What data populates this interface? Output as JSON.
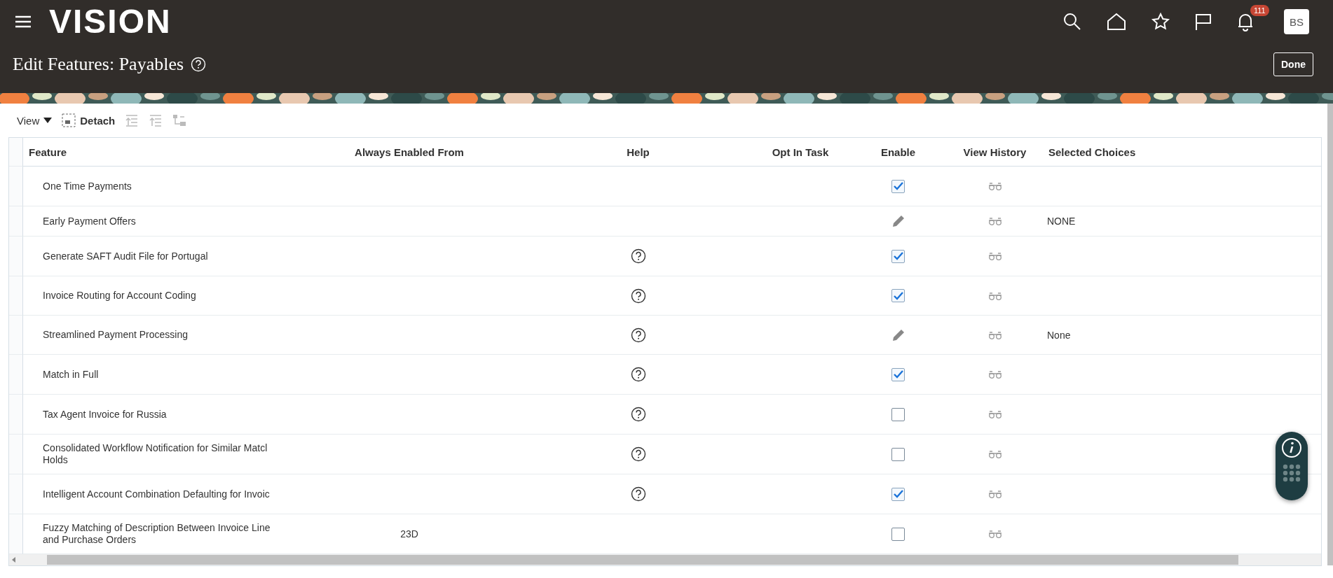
{
  "header": {
    "logo": "VISION",
    "notifications": "111",
    "avatar": "BS"
  },
  "page": {
    "title": "Edit Features: Payables",
    "done": "Done"
  },
  "toolbar": {
    "view": "View",
    "detach": "Detach"
  },
  "table": {
    "columns": [
      "Feature",
      "Always Enabled From",
      "Help",
      "Opt In Task",
      "Enable",
      "View History",
      "Selected Choices"
    ],
    "rows": [
      {
        "feature": "One Time Payments",
        "help": false,
        "enable": {
          "kind": "checkbox",
          "checked": true
        }
      },
      {
        "feature": "Early Payment Offers",
        "help": false,
        "enable": {
          "kind": "edit"
        },
        "selected_choices": "NONE"
      },
      {
        "feature": "Generate SAFT Audit File for Portugal",
        "help": true,
        "enable": {
          "kind": "checkbox",
          "checked": true
        }
      },
      {
        "feature": "Invoice Routing for Account Coding",
        "help": true,
        "enable": {
          "kind": "checkbox",
          "checked": true
        }
      },
      {
        "feature": "Streamlined Payment Processing",
        "help": true,
        "enable": {
          "kind": "edit"
        },
        "selected_choices": "None"
      },
      {
        "feature": "Match in Full",
        "help": true,
        "enable": {
          "kind": "checkbox",
          "checked": true
        }
      },
      {
        "feature": "Tax Agent Invoice for Russia",
        "help": true,
        "enable": {
          "kind": "checkbox",
          "checked": false
        }
      },
      {
        "feature": "Consolidated Workflow Notification for Similar Matcl Holds",
        "help": true,
        "enable": {
          "kind": "checkbox",
          "checked": false
        }
      },
      {
        "feature": "Intelligent Account Combination Defaulting for Invoic",
        "help": true,
        "enable": {
          "kind": "checkbox",
          "checked": true
        }
      },
      {
        "feature": "Fuzzy Matching of Description Between Invoice Line and Purchase Orders",
        "always_enabled_from": "23D",
        "help": false,
        "enable": {
          "kind": "checkbox",
          "checked": false
        }
      }
    ]
  }
}
